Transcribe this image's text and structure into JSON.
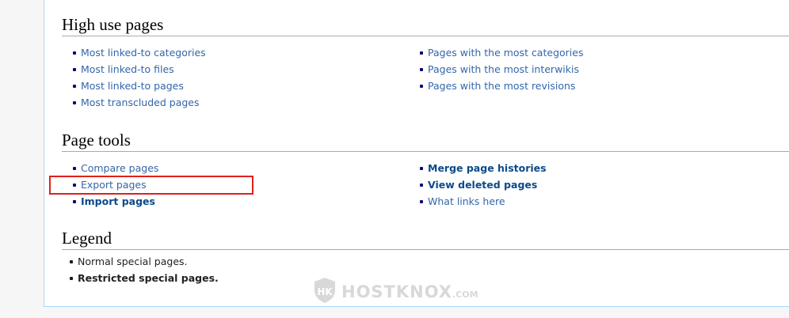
{
  "sections": {
    "high_use": {
      "title": "High use pages",
      "col1": [
        {
          "label": "Most linked-to categories"
        },
        {
          "label": "Most linked-to files"
        },
        {
          "label": "Most linked-to pages"
        },
        {
          "label": "Most transcluded pages"
        }
      ],
      "col2": [
        {
          "label": "Pages with the most categories"
        },
        {
          "label": "Pages with the most interwikis"
        },
        {
          "label": "Pages with the most revisions"
        }
      ]
    },
    "page_tools": {
      "title": "Page tools",
      "col1": [
        {
          "label": "Compare pages"
        },
        {
          "label": "Export pages"
        },
        {
          "label": "Import pages"
        }
      ],
      "col2": [
        {
          "label": "Merge page histories"
        },
        {
          "label": "View deleted pages"
        },
        {
          "label": "What links here"
        }
      ]
    },
    "legend": {
      "title": "Legend",
      "items": [
        {
          "label": "Normal special pages."
        },
        {
          "label": "Restricted special pages."
        }
      ]
    }
  },
  "watermark": {
    "brand": "HOSTKNOX",
    "suffix": ".COM"
  },
  "colors": {
    "link": "#3366aa",
    "restricted_link": "#0b4a8a",
    "highlight_box": "#e0201c",
    "border": "#a7d7f9"
  }
}
